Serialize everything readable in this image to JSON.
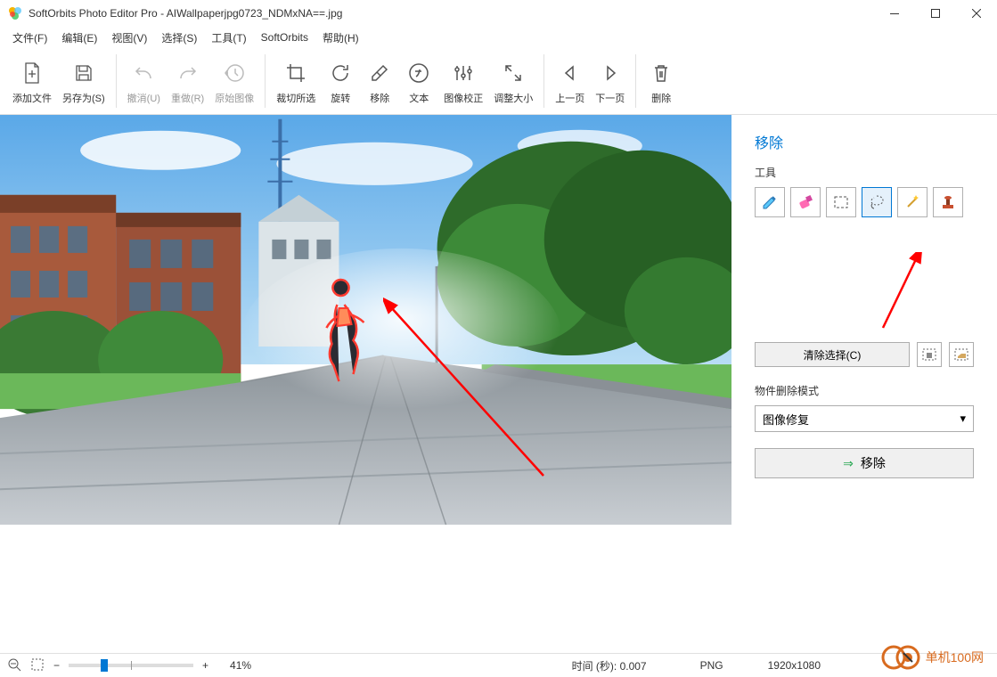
{
  "window": {
    "app_name": "SoftOrbits Photo Editor Pro",
    "file_name": "AIWallpaperjpg0723_NDMxNA==.jpg",
    "title_sep": " - "
  },
  "menu": {
    "file": "文件(F)",
    "edit": "编辑(E)",
    "view": "视图(V)",
    "select": "选择(S)",
    "tools": "工具(T)",
    "softorbits": "SoftOrbits",
    "help": "帮助(H)"
  },
  "toolbar": {
    "add_file": "添加文件",
    "save_as": "另存为(S)",
    "undo": "撤消(U)",
    "redo": "重做(R)",
    "original": "原始图像",
    "crop": "裁切所选",
    "rotate": "旋转",
    "remove": "移除",
    "text": "文本",
    "correction": "图像校正",
    "resize": "调整大小",
    "prev": "上一页",
    "next": "下一页",
    "delete": "删除"
  },
  "panel": {
    "title": "移除",
    "tools_label": "工具",
    "clear_selection": "清除选择(C)",
    "mode_label": "物件删除模式",
    "mode_value": "图像修复",
    "remove_btn": "移除"
  },
  "statusbar": {
    "zoom_pct": "41%",
    "time_label": "时间 (秒): ",
    "time_value": "0.007",
    "format": "PNG",
    "dimensions": "1920x1080"
  },
  "watermark": {
    "text": "单机100网"
  }
}
